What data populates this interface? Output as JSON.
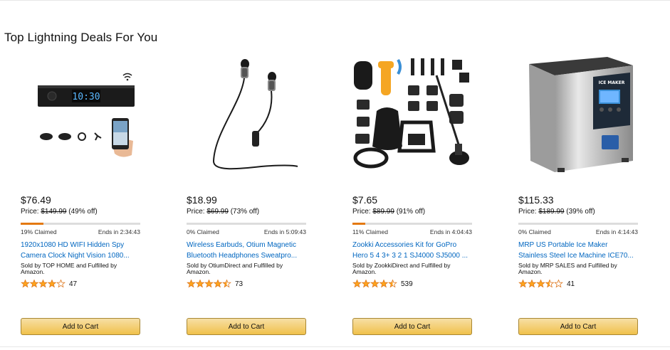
{
  "section": {
    "title": "Top Lightning Deals For You"
  },
  "deals": [
    {
      "price": "$76.49",
      "list_prefix": "Price: ",
      "list_price": "$149.99",
      "discount": "(49% off)",
      "claimed_label": "19% Claimed",
      "claimed_fraction": 0.19,
      "ends": "Ends in 2:34:43",
      "title": "1920x1080 HD WIFI Hidden Spy\nCamera Clock Night Vision 1080...",
      "seller": "Sold by TOP HOME and Fulfilled by Amazon.",
      "stars": 4.0,
      "reviews": "47",
      "cart_label": "Add to Cart",
      "image_text": "10:30",
      "image_icon": "spy-camera-clock-product-image"
    },
    {
      "price": "$18.99",
      "list_prefix": "Price: ",
      "list_price": "$69.99",
      "discount": "(73% off)",
      "claimed_label": "0% Claimed",
      "claimed_fraction": 0.0,
      "ends": "Ends in 5:09:43",
      "title": "Wireless Earbuds, Otium Magnetic\nBluetooth Headphones Sweatpro...",
      "seller": "Sold by OtiumDirect and Fulfilled by Amazon.",
      "stars": 4.5,
      "reviews": "73",
      "cart_label": "Add to Cart",
      "image_icon": "wireless-earbuds-product-image"
    },
    {
      "price": "$7.65",
      "list_prefix": "Price: ",
      "list_price": "$89.99",
      "discount": "(91% off)",
      "claimed_label": "11% Claimed",
      "claimed_fraction": 0.11,
      "ends": "Ends in 4:04:43",
      "title": "Zookki Accessories Kit for GoPro\nHero 5 4 3+ 3 2 1 SJ4000 SJ5000 ...",
      "seller": "Sold by ZookkiDirect and Fulfilled by Amazon.",
      "stars": 4.5,
      "reviews": "539",
      "cart_label": "Add to Cart",
      "image_icon": "gopro-accessories-kit-product-image"
    },
    {
      "price": "$115.33",
      "list_prefix": "Price: ",
      "list_price": "$189.99",
      "discount": "(39% off)",
      "claimed_label": "0% Claimed",
      "claimed_fraction": 0.0,
      "ends": "Ends in 4:14:43",
      "title": "MRP US Portable Ice Maker\nStainless Steel Ice Machine ICE70...",
      "seller": "Sold by MRP SALES and Fulfilled by Amazon.",
      "stars": 3.5,
      "reviews": "41",
      "cart_label": "Add to Cart",
      "image_text": "ICE MAKER",
      "image_icon": "ice-maker-product-image"
    }
  ],
  "colors": {
    "link": "#0066c0",
    "progress_fill": "#e47911",
    "progress_track": "#dddddd",
    "star_fill": "#ffa41c",
    "star_outline": "#de7921",
    "button_top": "#f7dfa5",
    "button_bottom": "#f0c14b"
  }
}
